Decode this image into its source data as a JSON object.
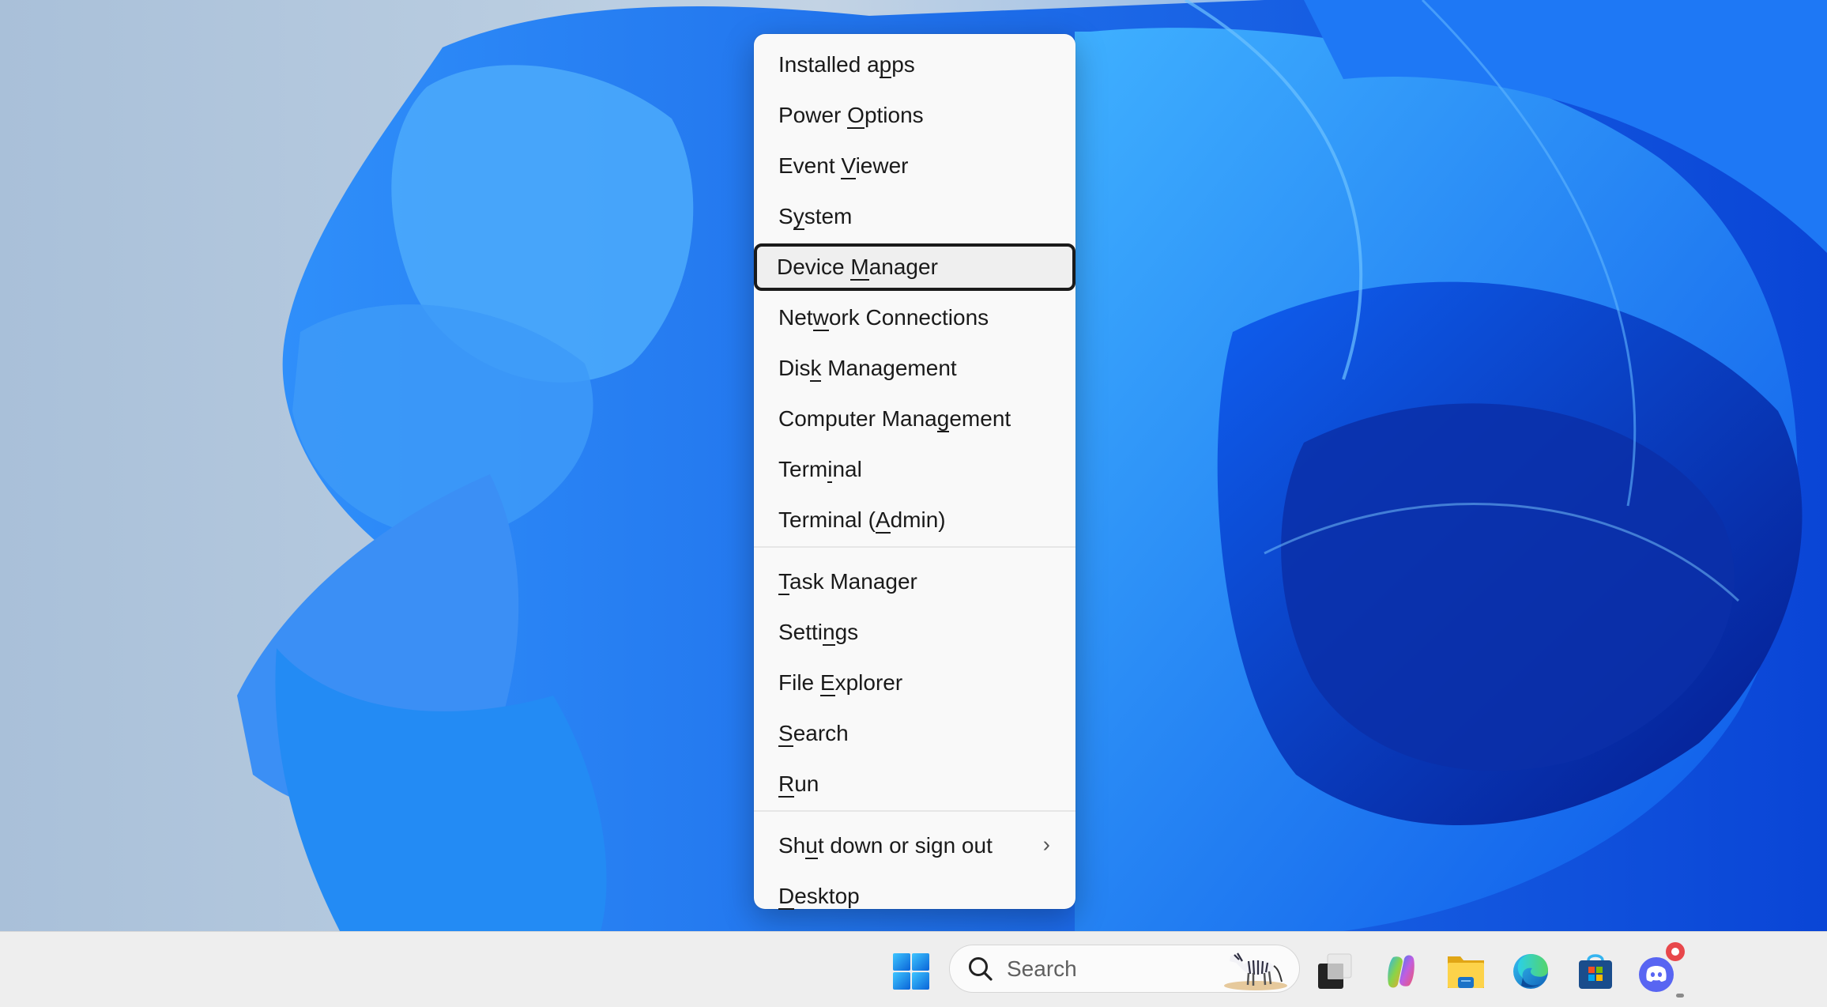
{
  "menu": {
    "groups": [
      [
        {
          "label_pre": "Installed a",
          "accel": "p",
          "label_post": "ps"
        },
        {
          "label_pre": "Power ",
          "accel": "O",
          "label_post": "ptions"
        },
        {
          "label_pre": "Event ",
          "accel": "V",
          "label_post": "iewer"
        },
        {
          "label_pre": "S",
          "accel": "y",
          "label_post": "stem"
        },
        {
          "label_pre": "Device ",
          "accel": "M",
          "label_post": "anager",
          "focused": true
        },
        {
          "label_pre": "Net",
          "accel": "w",
          "label_post": "ork Connections"
        },
        {
          "label_pre": "Dis",
          "accel": "k",
          "label_post": " Management"
        },
        {
          "label_pre": "Computer Mana",
          "accel": "g",
          "label_post": "ement"
        },
        {
          "label_pre": "Term",
          "accel": "i",
          "label_post": "nal"
        },
        {
          "label_pre": "Terminal (",
          "accel": "A",
          "label_post": "dmin)"
        }
      ],
      [
        {
          "label_pre": "",
          "accel": "T",
          "label_post": "ask Manager"
        },
        {
          "label_pre": "Setti",
          "accel": "n",
          "label_post": "gs"
        },
        {
          "label_pre": "File ",
          "accel": "E",
          "label_post": "xplorer"
        },
        {
          "label_pre": "",
          "accel": "S",
          "label_post": "earch"
        },
        {
          "label_pre": "",
          "accel": "R",
          "label_post": "un"
        }
      ],
      [
        {
          "label_pre": "Sh",
          "accel": "u",
          "label_post": "t down or sign out",
          "submenu": true,
          "submenu_icon": "chevron-right-icon",
          "chevron": "›"
        },
        {
          "label_pre": "",
          "accel": "D",
          "label_post": "esktop"
        }
      ]
    ]
  },
  "taskbar": {
    "start_icon": "windows-start-icon",
    "search": {
      "placeholder": "Search",
      "value": "",
      "highlight_icon": "zebra-search-highlight-icon"
    },
    "apps": [
      {
        "name": "task-view",
        "icon": "task-view-icon"
      },
      {
        "name": "copilot",
        "icon": "copilot-icon"
      },
      {
        "name": "file-explorer",
        "icon": "folder-icon"
      },
      {
        "name": "edge",
        "icon": "edge-icon"
      },
      {
        "name": "microsoft-store",
        "icon": "store-icon"
      },
      {
        "name": "discord",
        "icon": "discord-icon",
        "running": true,
        "badge": true
      }
    ]
  },
  "colors": {
    "menu_bg": "#f9f9f9",
    "focus_border": "#1a1a1a",
    "taskbar_bg": "#eeeeee",
    "wallpaper_blue": "#1a6cf0",
    "discord_blue": "#5865f2",
    "badge_red": "#e8474b"
  }
}
